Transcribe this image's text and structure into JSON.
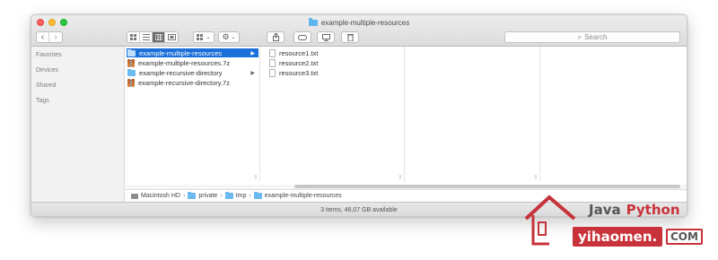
{
  "window": {
    "title": "example-multiple-resources"
  },
  "toolbar": {
    "back": "‹",
    "forward": "›",
    "search_placeholder": "Search"
  },
  "sidebar": {
    "sections": [
      "Favorites",
      "Devices",
      "Shared",
      "Tags"
    ]
  },
  "columns": {
    "col1": [
      {
        "name": "example-multiple-resources",
        "kind": "folder",
        "selected": true,
        "has_children": true
      },
      {
        "name": "example-multiple-resources.7z",
        "kind": "archive",
        "selected": false,
        "has_children": false
      },
      {
        "name": "example-recursive-directory",
        "kind": "folder",
        "selected": false,
        "has_children": true
      },
      {
        "name": "example-recursive-directory.7z",
        "kind": "archive",
        "selected": false,
        "has_children": false
      }
    ],
    "col2": [
      {
        "name": "resource1.txt",
        "kind": "text"
      },
      {
        "name": "resource2.txt",
        "kind": "text"
      },
      {
        "name": "resource3.txt",
        "kind": "text"
      }
    ]
  },
  "pathbar": [
    "Macintosh HD",
    "private",
    "tmp",
    "example-multiple-resources"
  ],
  "status": "3 items, 48,07 GB available",
  "watermark": {
    "line1a": "Java",
    "line1b": "Python",
    "line2a": "yihaomen.",
    "line2b": "COM"
  },
  "colors": {
    "selection": "#1b6fd9",
    "folder": "#6cbaf0",
    "brand_red": "#c8323a"
  }
}
